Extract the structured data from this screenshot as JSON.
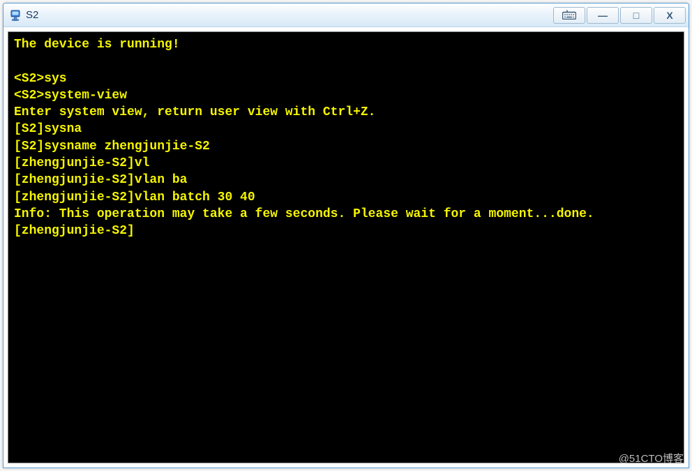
{
  "window": {
    "title": "S2",
    "controls": {
      "restore_label": "❐",
      "keyboard_label": "⌨",
      "minimize_label": "—",
      "maximize_label": "□",
      "close_label": "X"
    }
  },
  "terminal": {
    "text_color": "#f5f500",
    "bg_color": "#000000",
    "lines": [
      "The device is running!",
      "",
      "<S2>sys",
      "<S2>system-view",
      "Enter system view, return user view with Ctrl+Z.",
      "[S2]sysna",
      "[S2]sysname zhengjunjie-S2",
      "[zhengjunjie-S2]vl",
      "[zhengjunjie-S2]vlan ba",
      "[zhengjunjie-S2]vlan batch 30 40",
      "Info: This operation may take a few seconds. Please wait for a moment...done.",
      "[zhengjunjie-S2]"
    ]
  },
  "watermark": "@51CTO博客"
}
